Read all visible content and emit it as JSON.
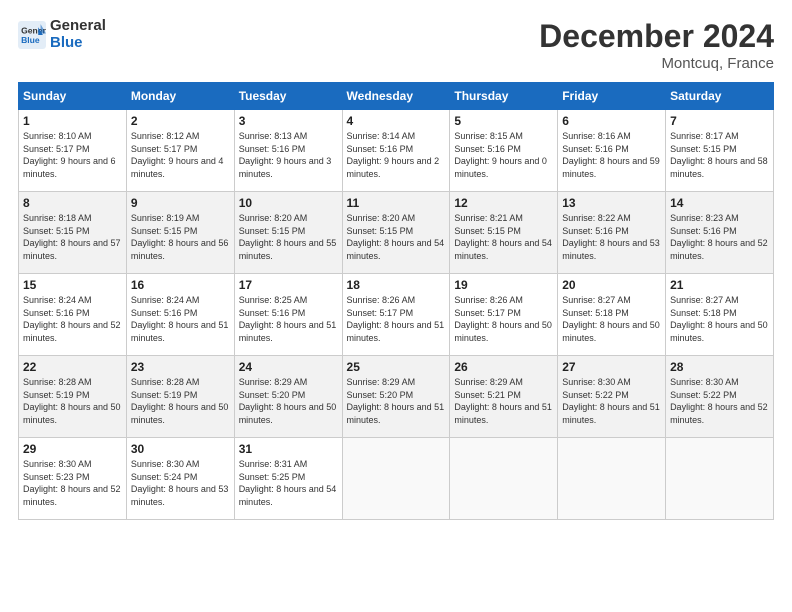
{
  "header": {
    "logo_line1": "General",
    "logo_line2": "Blue",
    "month_title": "December 2024",
    "subtitle": "Montcuq, France"
  },
  "weekdays": [
    "Sunday",
    "Monday",
    "Tuesday",
    "Wednesday",
    "Thursday",
    "Friday",
    "Saturday"
  ],
  "weeks": [
    [
      {
        "day": "1",
        "sunrise": "8:10 AM",
        "sunset": "5:17 PM",
        "daylight": "9 hours and 6 minutes."
      },
      {
        "day": "2",
        "sunrise": "8:12 AM",
        "sunset": "5:17 PM",
        "daylight": "9 hours and 4 minutes."
      },
      {
        "day": "3",
        "sunrise": "8:13 AM",
        "sunset": "5:16 PM",
        "daylight": "9 hours and 3 minutes."
      },
      {
        "day": "4",
        "sunrise": "8:14 AM",
        "sunset": "5:16 PM",
        "daylight": "9 hours and 2 minutes."
      },
      {
        "day": "5",
        "sunrise": "8:15 AM",
        "sunset": "5:16 PM",
        "daylight": "9 hours and 0 minutes."
      },
      {
        "day": "6",
        "sunrise": "8:16 AM",
        "sunset": "5:16 PM",
        "daylight": "8 hours and 59 minutes."
      },
      {
        "day": "7",
        "sunrise": "8:17 AM",
        "sunset": "5:15 PM",
        "daylight": "8 hours and 58 minutes."
      }
    ],
    [
      {
        "day": "8",
        "sunrise": "8:18 AM",
        "sunset": "5:15 PM",
        "daylight": "8 hours and 57 minutes."
      },
      {
        "day": "9",
        "sunrise": "8:19 AM",
        "sunset": "5:15 PM",
        "daylight": "8 hours and 56 minutes."
      },
      {
        "day": "10",
        "sunrise": "8:20 AM",
        "sunset": "5:15 PM",
        "daylight": "8 hours and 55 minutes."
      },
      {
        "day": "11",
        "sunrise": "8:20 AM",
        "sunset": "5:15 PM",
        "daylight": "8 hours and 54 minutes."
      },
      {
        "day": "12",
        "sunrise": "8:21 AM",
        "sunset": "5:15 PM",
        "daylight": "8 hours and 54 minutes."
      },
      {
        "day": "13",
        "sunrise": "8:22 AM",
        "sunset": "5:16 PM",
        "daylight": "8 hours and 53 minutes."
      },
      {
        "day": "14",
        "sunrise": "8:23 AM",
        "sunset": "5:16 PM",
        "daylight": "8 hours and 52 minutes."
      }
    ],
    [
      {
        "day": "15",
        "sunrise": "8:24 AM",
        "sunset": "5:16 PM",
        "daylight": "8 hours and 52 minutes."
      },
      {
        "day": "16",
        "sunrise": "8:24 AM",
        "sunset": "5:16 PM",
        "daylight": "8 hours and 51 minutes."
      },
      {
        "day": "17",
        "sunrise": "8:25 AM",
        "sunset": "5:16 PM",
        "daylight": "8 hours and 51 minutes."
      },
      {
        "day": "18",
        "sunrise": "8:26 AM",
        "sunset": "5:17 PM",
        "daylight": "8 hours and 51 minutes."
      },
      {
        "day": "19",
        "sunrise": "8:26 AM",
        "sunset": "5:17 PM",
        "daylight": "8 hours and 50 minutes."
      },
      {
        "day": "20",
        "sunrise": "8:27 AM",
        "sunset": "5:18 PM",
        "daylight": "8 hours and 50 minutes."
      },
      {
        "day": "21",
        "sunrise": "8:27 AM",
        "sunset": "5:18 PM",
        "daylight": "8 hours and 50 minutes."
      }
    ],
    [
      {
        "day": "22",
        "sunrise": "8:28 AM",
        "sunset": "5:19 PM",
        "daylight": "8 hours and 50 minutes."
      },
      {
        "day": "23",
        "sunrise": "8:28 AM",
        "sunset": "5:19 PM",
        "daylight": "8 hours and 50 minutes."
      },
      {
        "day": "24",
        "sunrise": "8:29 AM",
        "sunset": "5:20 PM",
        "daylight": "8 hours and 50 minutes."
      },
      {
        "day": "25",
        "sunrise": "8:29 AM",
        "sunset": "5:20 PM",
        "daylight": "8 hours and 51 minutes."
      },
      {
        "day": "26",
        "sunrise": "8:29 AM",
        "sunset": "5:21 PM",
        "daylight": "8 hours and 51 minutes."
      },
      {
        "day": "27",
        "sunrise": "8:30 AM",
        "sunset": "5:22 PM",
        "daylight": "8 hours and 51 minutes."
      },
      {
        "day": "28",
        "sunrise": "8:30 AM",
        "sunset": "5:22 PM",
        "daylight": "8 hours and 52 minutes."
      }
    ],
    [
      {
        "day": "29",
        "sunrise": "8:30 AM",
        "sunset": "5:23 PM",
        "daylight": "8 hours and 52 minutes."
      },
      {
        "day": "30",
        "sunrise": "8:30 AM",
        "sunset": "5:24 PM",
        "daylight": "8 hours and 53 minutes."
      },
      {
        "day": "31",
        "sunrise": "8:31 AM",
        "sunset": "5:25 PM",
        "daylight": "8 hours and 54 minutes."
      },
      null,
      null,
      null,
      null
    ]
  ],
  "labels": {
    "sunrise": "Sunrise:",
    "sunset": "Sunset:",
    "daylight": "Daylight:"
  }
}
